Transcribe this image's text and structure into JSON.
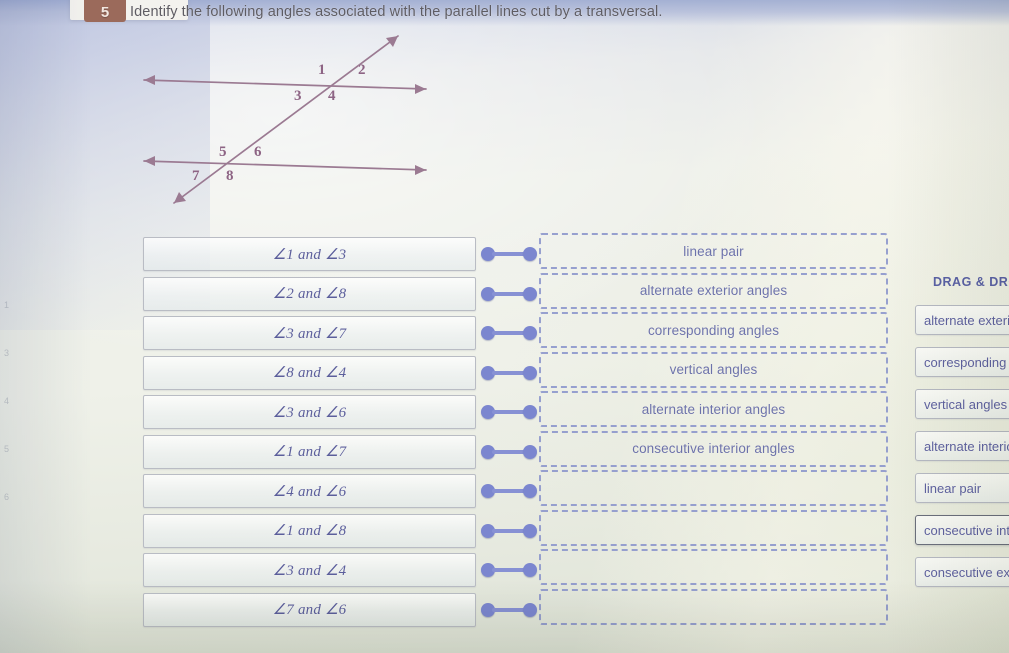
{
  "header": {
    "question_number": "5",
    "prompt": "Identify the following angles associated with the parallel lines cut by a transversal."
  },
  "figure": {
    "description": "two parallel lines cut by a transversal",
    "angle_labels": [
      "1",
      "2",
      "3",
      "4",
      "5",
      "6",
      "7",
      "8"
    ],
    "line_color": "#9b7a92"
  },
  "edge_numbers": [
    "1",
    "3",
    "4",
    "5",
    "6"
  ],
  "drag_panel": {
    "title": "DRAG & DROP",
    "chips": [
      {
        "label": "alternate exterior angles",
        "selected": false
      },
      {
        "label": "corresponding angles",
        "selected": false
      },
      {
        "label": "vertical angles",
        "selected": false
      },
      {
        "label": "alternate interior angles",
        "selected": false
      },
      {
        "label": "linear pair",
        "selected": false
      },
      {
        "label": "consecutive interior angles",
        "selected": true
      },
      {
        "label": "consecutive exterior angles",
        "selected": false
      }
    ]
  },
  "rows": [
    {
      "item": "∠1 and ∠3",
      "answer": "linear pair"
    },
    {
      "item": "∠2 and ∠8",
      "answer": "alternate exterior angles"
    },
    {
      "item": "∠3 and ∠7",
      "answer": "corresponding angles"
    },
    {
      "item": "∠8 and ∠4",
      "answer": "vertical angles"
    },
    {
      "item": "∠3 and ∠6",
      "answer": "alternate interior angles"
    },
    {
      "item": "∠1 and ∠7",
      "answer": "consecutive interior angles"
    },
    {
      "item": "∠4 and ∠6",
      "answer": ""
    },
    {
      "item": "∠1 and ∠8",
      "answer": ""
    },
    {
      "item": "∠3 and ∠4",
      "answer": ""
    },
    {
      "item": "∠7 and ∠6",
      "answer": ""
    }
  ],
  "colors": {
    "badge": "#9b6a5b",
    "connector": "#7b86cf",
    "dropzone_border": "#8b95cc",
    "item_text": "#5b5e9b"
  }
}
